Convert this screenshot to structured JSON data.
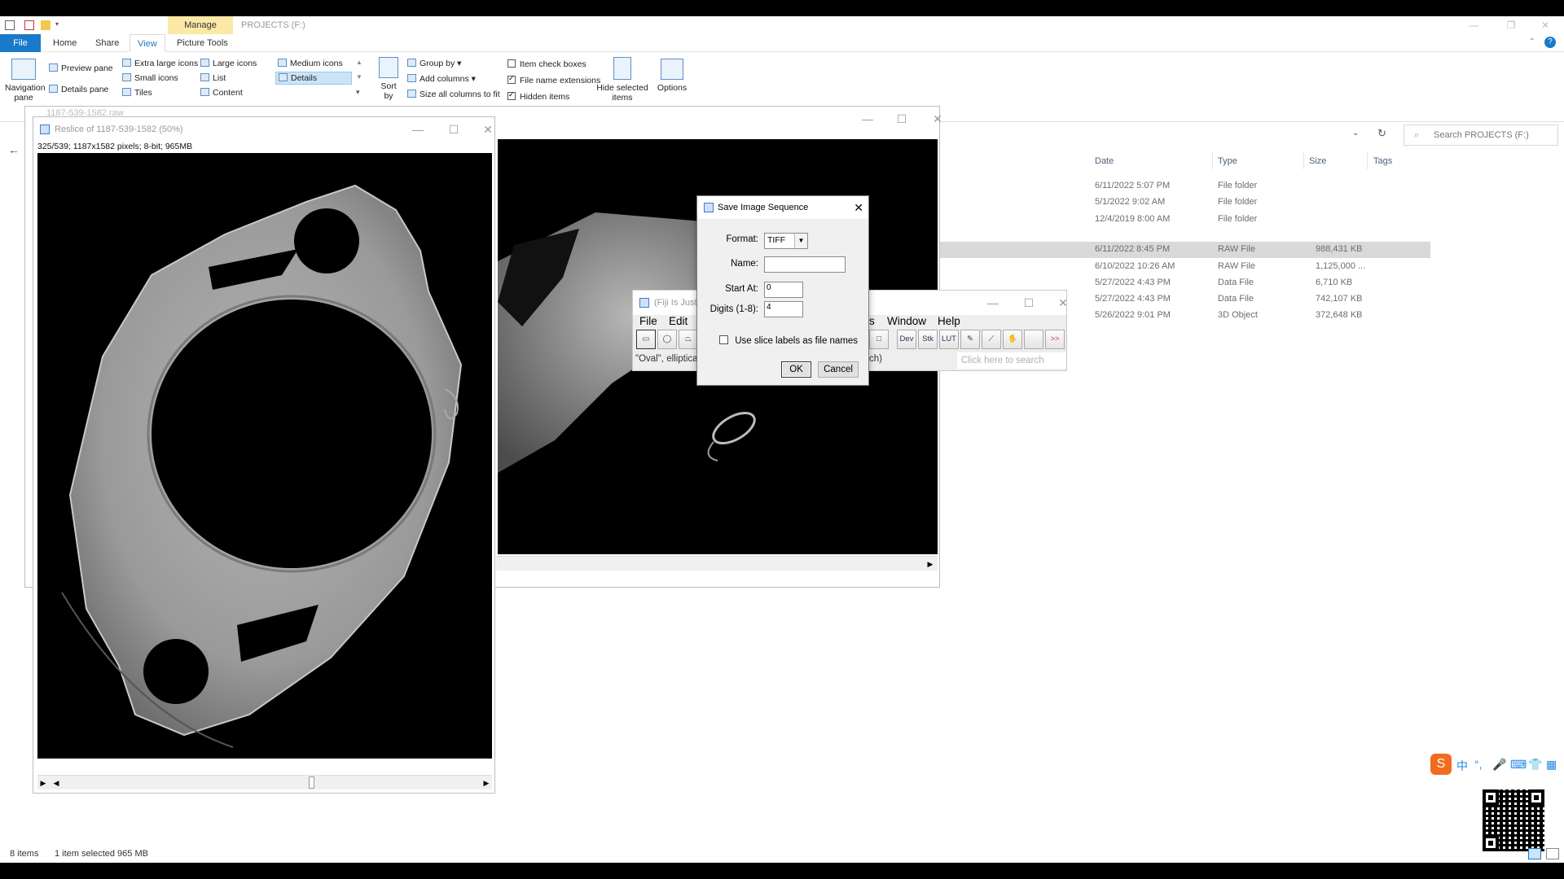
{
  "explorer": {
    "context_tab": "Manage",
    "window_title": "PROJECTS (F:)",
    "tabs": [
      "File",
      "Home",
      "Share",
      "View",
      "Picture Tools"
    ],
    "active_tab": "View",
    "ribbon": {
      "navigation_pane": "Navigation pane",
      "preview_pane": "Preview pane",
      "details_pane": "Details pane",
      "layout": [
        "Extra large icons",
        "Large icons",
        "Medium icons",
        "Small icons",
        "List",
        "Details",
        "Tiles",
        "Content"
      ],
      "sort_by": "Sort by",
      "group_by": "Group by",
      "add_columns": "Add columns",
      "size_all_columns": "Size all columns to fit",
      "item_check_boxes": "Item check boxes",
      "file_name_extensions": "File name extensions",
      "hidden_items": "Hidden items",
      "hide_selected": "Hide selected items",
      "options": "Options"
    },
    "search_placeholder": "Search PROJECTS (F:)",
    "columns": [
      "Date",
      "Type",
      "Size",
      "Tags"
    ],
    "rows": [
      {
        "date": "6/11/2022 5:07 PM",
        "type": "File folder",
        "size": ""
      },
      {
        "date": "5/1/2022 9:02 AM",
        "type": "File folder",
        "size": ""
      },
      {
        "date": "12/4/2019 8:00 AM",
        "type": "File folder",
        "size": ""
      },
      {
        "date": "6/11/2022 8:45 PM",
        "type": "RAW File",
        "size": "988,431 KB"
      },
      {
        "date": "6/10/2022 10:26 AM",
        "type": "RAW File",
        "size": "1,125,000 ..."
      },
      {
        "date": "5/27/2022 4:43 PM",
        "type": "Data File",
        "size": "6,710 KB"
      },
      {
        "date": "5/27/2022 4:43 PM",
        "type": "Data File",
        "size": "742,107 KB"
      },
      {
        "date": "5/26/2022 9:01 PM",
        "type": "3D Object",
        "size": "372,648 KB"
      }
    ],
    "selected_row": 3,
    "status_items": "8 items",
    "status_selected": "1 item selected  965 MB"
  },
  "back_image": {
    "title": "1187-539-1582.raw"
  },
  "reslice": {
    "title": "Reslice of 1187-539-1582 (50%)",
    "info": "325/539; 1187x1582 pixels; 8-bit; 965MB"
  },
  "fiji": {
    "title": "(Fiji Is Just",
    "menus": [
      "File",
      "Edit",
      "s",
      "Window",
      "Help"
    ],
    "tools": [
      "Dev",
      "Stk",
      "LUT",
      ">>"
    ],
    "status": "\"Oval\", elliptica",
    "status_tail": "ch)",
    "search_placeholder": "Click here to search"
  },
  "dialog": {
    "title": "Save Image Sequence",
    "format_label": "Format:",
    "format_value": "TIFF",
    "name_label": "Name:",
    "name_value": "",
    "start_label": "Start At:",
    "start_value": "0",
    "digits_label": "Digits (1-8):",
    "digits_value": "4",
    "slice_labels": "Use slice labels as file names",
    "slice_labels_checked": false,
    "ok": "OK",
    "cancel": "Cancel"
  },
  "ime": {
    "chars": [
      "中",
      "°,"
    ]
  },
  "colors": {
    "accent": "#1979ca",
    "context_tab": "#fbe9a5",
    "selected_row": "#d9d9d9"
  }
}
